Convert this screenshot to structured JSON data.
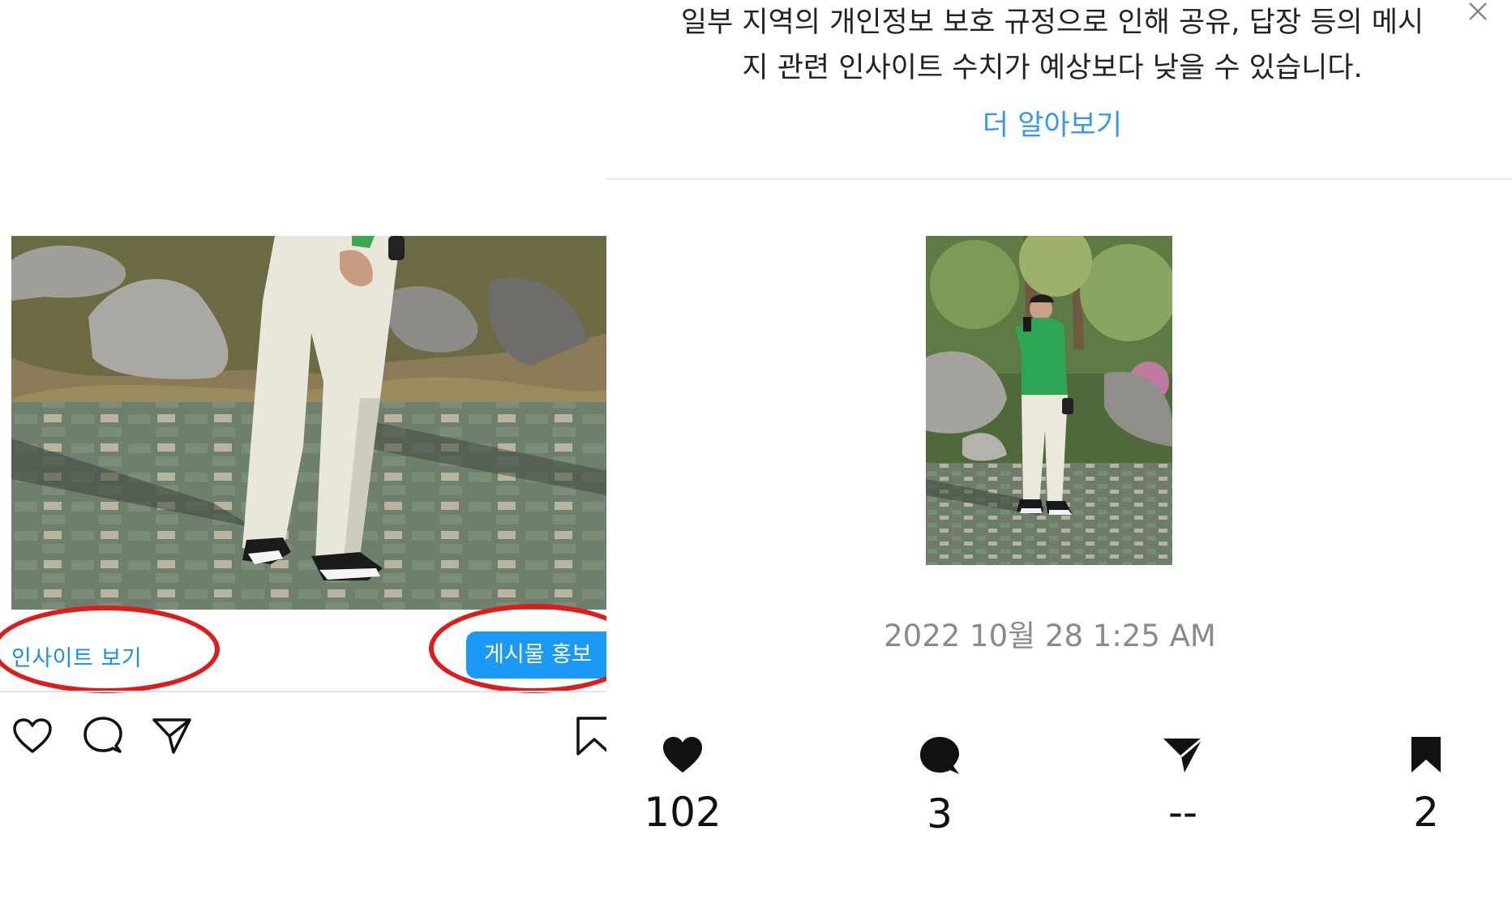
{
  "left_post": {
    "insights_link": "인사이트 보기",
    "promote_button": "게시물 홍보",
    "icons": [
      "heart-outline-icon",
      "comment-outline-icon",
      "share-plane-icon",
      "bookmark-outline-icon"
    ],
    "highlight_color": "#e01b1b",
    "accent": "#1a9af6"
  },
  "insights": {
    "privacy_notice": {
      "line1": "일부 지역의 개인정보 보호 규정으로 인해 공유, 답장 등의 메시",
      "line2": "지 관련 인사이트 수치가 예상보다 낮을 수 있습니다."
    },
    "learn_more": "더 알아보기",
    "post_date": "2022 10월 28 1:25 AM",
    "stats": [
      {
        "icon": "heart-filled-icon",
        "value": "102"
      },
      {
        "icon": "comment-filled-icon",
        "value": "3"
      },
      {
        "icon": "share-filled-icon",
        "value": "--"
      },
      {
        "icon": "bookmark-filled-icon",
        "value": "2"
      }
    ],
    "link_color": "#3897f0"
  }
}
